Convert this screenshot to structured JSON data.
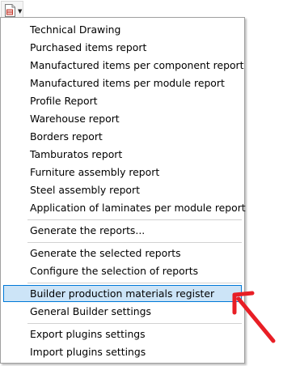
{
  "toolbar": {
    "reports_button_icon": "report-document-icon",
    "dropdown_icon": "triangle-down-icon"
  },
  "menu": {
    "group1": [
      "Technical Drawing",
      "Purchased items report",
      "Manufactured items per component report",
      "Manufactured items per module report",
      "Profile Report",
      "Warehouse report",
      "Borders report",
      "Tamburatos report",
      "Furniture assembly report",
      "Steel assembly report",
      "Application of laminates per module report"
    ],
    "group2": [
      "Generate the reports..."
    ],
    "group3": [
      "Generate the selected reports",
      "Configure the selection of reports"
    ],
    "group4": [
      "Builder production materials register",
      "General Builder settings"
    ],
    "group5": [
      "Export plugins settings",
      "Import plugins settings"
    ],
    "highlighted_item": "Builder production materials register",
    "highlight_color": "#cce4f7",
    "highlight_border_color": "#0078d7"
  },
  "annotation": {
    "arrow_icon": "red-arrow-icon",
    "color": "#e81e25"
  }
}
